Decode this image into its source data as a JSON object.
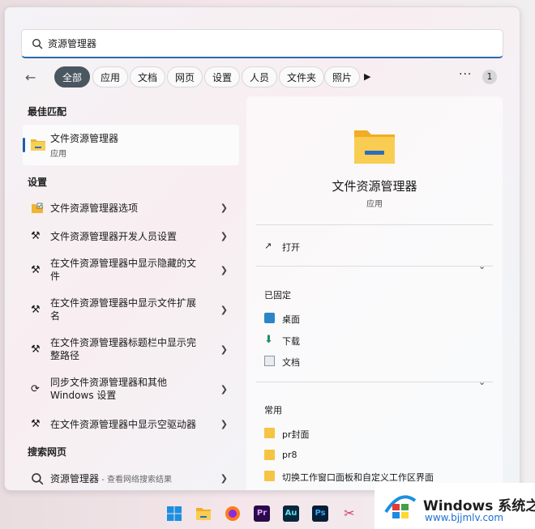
{
  "search": {
    "value": "资源管理器"
  },
  "filters": [
    "全部",
    "应用",
    "文档",
    "网页",
    "设置",
    "人员",
    "文件夹",
    "照片"
  ],
  "more_label": "···",
  "badge": "1",
  "best_match": {
    "header": "最佳匹配",
    "title": "文件资源管理器",
    "subtitle": "应用"
  },
  "settings": {
    "header": "设置",
    "items": [
      {
        "label": "文件资源管理器选项"
      },
      {
        "label": "文件资源管理器开发人员设置"
      },
      {
        "label": "在文件资源管理器中显示隐藏的文件"
      },
      {
        "label": "在文件资源管理器中显示文件扩展名"
      },
      {
        "label": "在文件资源管理器标题栏中显示完整路径"
      },
      {
        "label": "同步文件资源管理器和其他 Windows 设置"
      },
      {
        "label": "在文件资源管理器中显示空驱动器"
      }
    ]
  },
  "web": {
    "header": "搜索网页",
    "item_label": "资源管理器",
    "item_suffix": " - 查看网络搜索结果"
  },
  "preview": {
    "title": "文件资源管理器",
    "subtitle": "应用",
    "open_label": "打开",
    "pinned_header": "已固定",
    "pinned": [
      "桌面",
      "下载",
      "文档"
    ],
    "recent_header": "常用",
    "recent": [
      "pr封面",
      "pr8",
      "切换工作窗口面板和自定义工作区界面"
    ]
  },
  "taskbar": {
    "icons": [
      "windows-start",
      "file-explorer",
      "firefox",
      "premiere",
      "audition",
      "photoshop",
      "snipping-tool"
    ]
  },
  "watermark": {
    "text": "Windows 系统之家",
    "url": "www.bjjmlv.com"
  },
  "colors": {
    "accent": "#2b6aa8",
    "chip_active": "#4a5660",
    "folder": "#f6c443"
  }
}
